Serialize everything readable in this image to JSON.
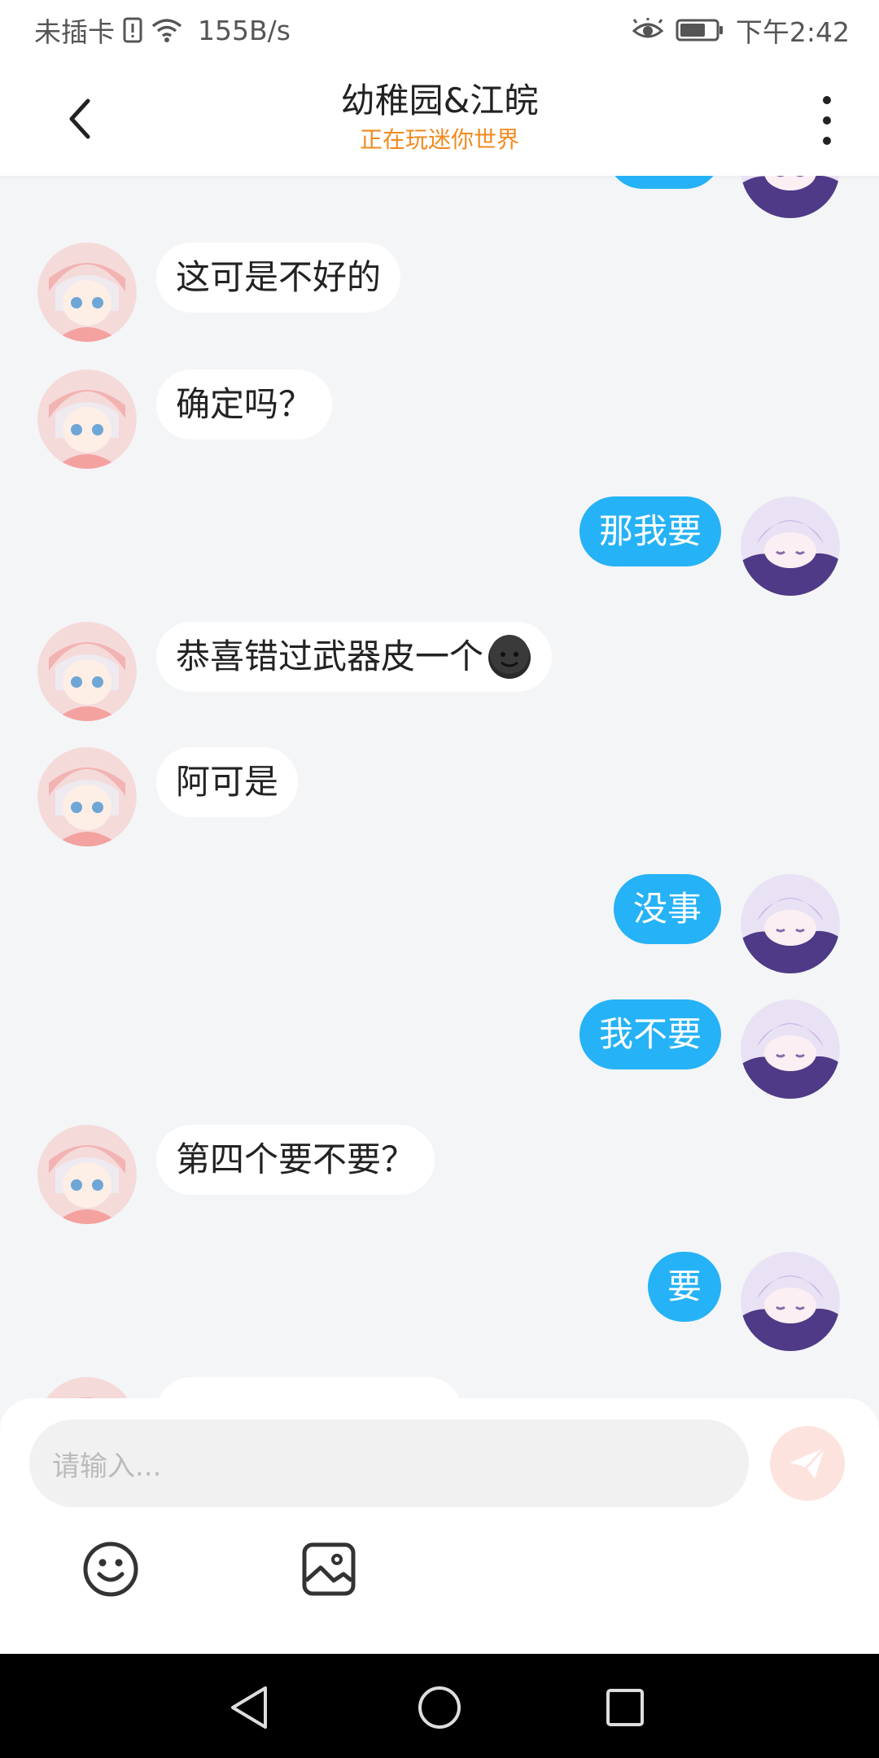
{
  "status_bar": {
    "carrier": "未插卡",
    "speed": "155B/s",
    "time": "下午2:42",
    "icons": [
      "sim-alert-icon",
      "wifi-icon",
      "eye-icon",
      "battery-icon"
    ]
  },
  "header": {
    "title": "幼稚园&江皖",
    "subtitle": "正在玩迷你世界",
    "back_icon": "back-arrow-icon",
    "more_icon": "more-vertical-icon"
  },
  "messages": [
    {
      "side": "left",
      "text": "这可是不好的"
    },
    {
      "side": "left",
      "text": "确定吗？"
    },
    {
      "side": "right",
      "text": "那我要"
    },
    {
      "side": "left",
      "text": "恭喜错过武器皮一个",
      "emoji": "dark-smiley-emoji"
    },
    {
      "side": "left",
      "text": "阿可是"
    },
    {
      "side": "right",
      "text": "没事"
    },
    {
      "side": "right",
      "text": "我不要"
    },
    {
      "side": "left",
      "text": "第四个要不要？"
    },
    {
      "side": "right",
      "text": "要"
    }
  ],
  "input": {
    "placeholder": "请输入...",
    "send_icon": "send-icon",
    "tools": [
      "emoji-icon",
      "image-icon"
    ]
  },
  "nav_bar": [
    "back-triangle-icon",
    "home-circle-icon",
    "recents-square-icon"
  ],
  "colors": {
    "accent_blue": "#26b2f6",
    "subtitle_orange": "#f08a1f",
    "background": "#f4f5f7"
  }
}
